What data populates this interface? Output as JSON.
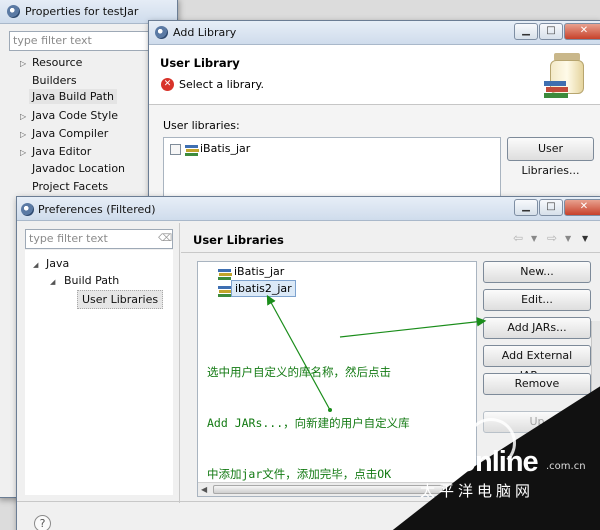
{
  "properties_window": {
    "title": "Properties for testJar",
    "filter_placeholder": "type filter text",
    "tree": [
      "Resource",
      "Builders",
      "Java Build Path",
      "Java Code Style",
      "Java Compiler",
      "Java Editor",
      "Javadoc Location",
      "Project Facets"
    ],
    "selected_item": "Java Build Path"
  },
  "add_library_dialog": {
    "title": "Add Library",
    "header_title": "User Library",
    "header_message": "Select a library.",
    "section_label": "User libraries:",
    "libraries": [
      "iBatis_jar"
    ],
    "user_libraries_button": "User Libraries..."
  },
  "preferences_window": {
    "title": "Preferences (Filtered)",
    "filter_placeholder": "type filter text",
    "tree": [
      {
        "label": "Java",
        "level": 0
      },
      {
        "label": "Build Path",
        "level": 1
      },
      {
        "label": "User Libraries",
        "level": 2
      }
    ],
    "selected_item": "User Libraries",
    "page_title": "User Libraries",
    "libraries": [
      "iBatis_jar",
      "ibatis2_jar"
    ],
    "selected_library": "ibatis2_jar",
    "buttons": {
      "new": "New...",
      "edit": "Edit...",
      "add_jars": "Add JARs...",
      "add_external_jars": "Add External JARs...",
      "remove": "Remove",
      "up": "Up"
    },
    "help_glyph": "?"
  },
  "annotation": {
    "line1": "选中用户自定义的库名称，然后点击",
    "line2": "Add JARs...，向新建的用户自定义库",
    "line3": "中添加jar文件，添加完毕，点击OK",
    "color": "#137a13"
  },
  "watermark": {
    "brand": "PConline",
    "domain": ".com.cn",
    "tagline": "太平洋电脑网"
  }
}
